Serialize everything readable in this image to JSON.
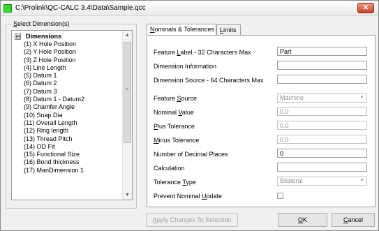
{
  "window": {
    "title": "C:\\Prolink\\QC-CALC 3.4\\Data\\Sample.qcc",
    "close_glyph": "✕",
    "icon": "app-icon"
  },
  "dimensions_group": {
    "legend_pre": "",
    "legend_key": "S",
    "legend_post": "elect Dimension(s)",
    "tree_header": "Dimensions",
    "expander_glyph": "⊟",
    "items": [
      "(1) X Hole Position",
      "(2) Y Hole Position",
      "(3) Z Hole Position",
      "(4) Line Length",
      "(5) Datum 1",
      "(6) Datum 2",
      "(7) Datum 3",
      "(8) Datum 1 - Datum2",
      "(9) Chamfer Angle",
      "(10) Snap Dia",
      "(11) Overall Length",
      "(12) Ring length",
      "(13) Thread Pitch",
      "(14) OD Fit",
      "(15) Functional Size",
      "(16) Bond thickness",
      "(17) ManDimension 1"
    ],
    "scroll_up": "▲",
    "scroll_down": "▼",
    "grip": "≡"
  },
  "tabs": [
    {
      "pre": "",
      "key": "N",
      "post": "ominals & Tolerances"
    },
    {
      "pre": "",
      "key": "L",
      "post": "imits"
    }
  ],
  "form": {
    "feature_label": {
      "pre": "Feature ",
      "key": "L",
      "post": "abel - 32 Characters Max",
      "value": "Part"
    },
    "dimension_information": {
      "label": "Dimension Information",
      "value": ""
    },
    "dimension_source": {
      "label": "Dimension Source - 64 Characters Max",
      "value": ""
    },
    "feature_source": {
      "pre": "Feature ",
      "key": "S",
      "post": "ource",
      "value": "Machine",
      "arrow": "▼"
    },
    "nominal_value": {
      "pre": "Nominal ",
      "key": "V",
      "post": "alue",
      "value": "0.0"
    },
    "plus_tolerance": {
      "pre": "",
      "key": "P",
      "post": "lus Tolerance",
      "value": "0.0"
    },
    "minus_tolerance": {
      "pre": "",
      "key": "M",
      "post": "inus Tolerance",
      "value": "0.0"
    },
    "decimal_places": {
      "label": "Number of Decimal Places",
      "value": "0"
    },
    "calculation": {
      "label": "Calculation",
      "value": ""
    },
    "tolerance_type": {
      "pre": "Tolerance ",
      "key": "T",
      "post": "ype",
      "value": "Bilateral",
      "arrow": "▼"
    },
    "prevent_nominal_update": {
      "pre": "Prevent Nominal ",
      "key": "U",
      "post": "pdate"
    }
  },
  "buttons": {
    "apply": {
      "pre": "",
      "key": "A",
      "post": "pply Changes To Selection"
    },
    "ok": {
      "pre": "",
      "key": "O",
      "post": "K"
    },
    "cancel": {
      "pre": "",
      "key": "C",
      "post": "ancel"
    }
  }
}
